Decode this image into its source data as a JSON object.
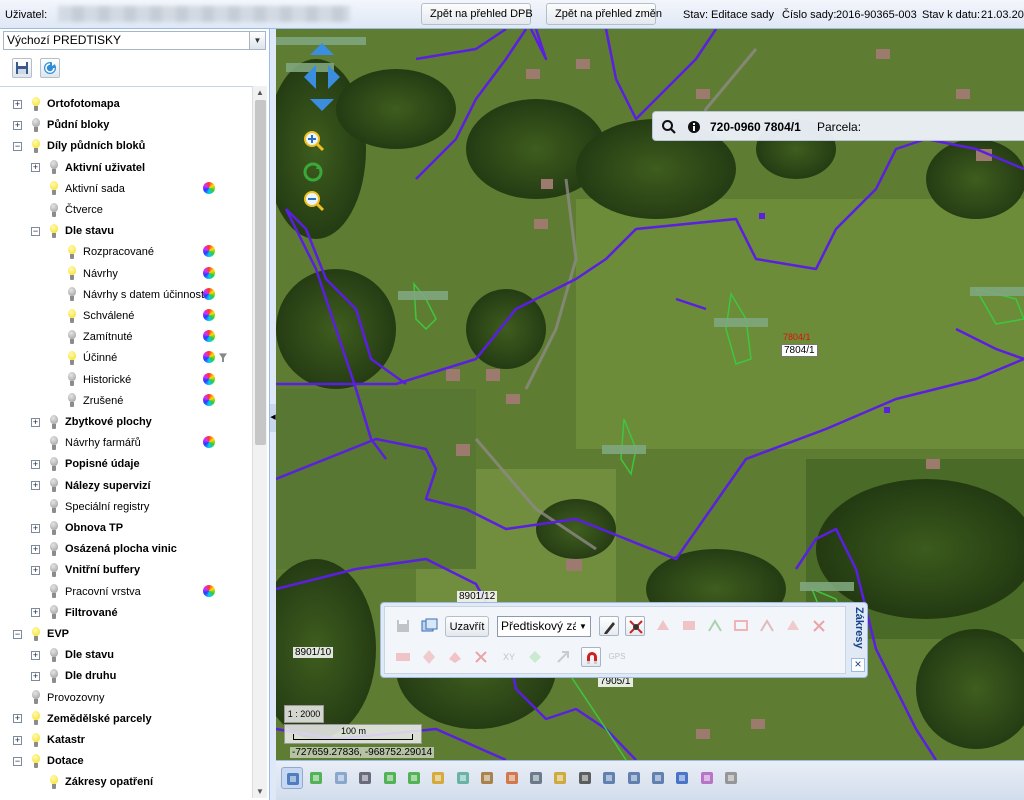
{
  "topbar": {
    "user_label": "Uživatel:",
    "btn_dpb": "Zpět na přehled DPB",
    "btn_changes": "Zpět na přehled změn",
    "state_label": "Stav:",
    "state_value": "Editace sady",
    "set_label": "Číslo sady:",
    "set_value": "2016-90365-003",
    "date_label": "Stav k datu:",
    "date_value": "21.03.20"
  },
  "left_panel": {
    "preset_value": "Výchozí PREDTISKY",
    "tools": [
      "save-icon",
      "refresh-icon"
    ],
    "tree": [
      {
        "label": "Ortofotomapa",
        "bold": true,
        "exp": "+",
        "bulb": "on",
        "indent": 0
      },
      {
        "label": "Půdní bloky",
        "bold": true,
        "exp": "+",
        "bulb": "off",
        "indent": 0
      },
      {
        "label": "Díly půdních bloků",
        "bold": true,
        "exp": "−",
        "bulb": "on",
        "indent": 0
      },
      {
        "label": "Aktivní uživatel",
        "bold": true,
        "exp": "+",
        "bulb": "off",
        "indent": 1
      },
      {
        "label": "Aktivní sada",
        "bold": false,
        "exp": "",
        "bulb": "on",
        "indent": 1,
        "wheel": true
      },
      {
        "label": "Čtverce",
        "bold": false,
        "exp": "",
        "bulb": "off",
        "indent": 1
      },
      {
        "label": "Dle stavu",
        "bold": true,
        "exp": "−",
        "bulb": "on",
        "indent": 1
      },
      {
        "label": "Rozpracované",
        "bold": false,
        "exp": "",
        "bulb": "on",
        "indent": 2,
        "wheel": true
      },
      {
        "label": "Návrhy",
        "bold": false,
        "exp": "",
        "bulb": "on",
        "indent": 2,
        "wheel": true
      },
      {
        "label": "Návrhy s datem účinnosti",
        "bold": false,
        "exp": "",
        "bulb": "off",
        "indent": 2,
        "wheel": true
      },
      {
        "label": "Schválené",
        "bold": false,
        "exp": "",
        "bulb": "on",
        "indent": 2,
        "wheel": true
      },
      {
        "label": "Zamítnuté",
        "bold": false,
        "exp": "",
        "bulb": "off",
        "indent": 2,
        "wheel": true
      },
      {
        "label": "Účinné",
        "bold": false,
        "exp": "",
        "bulb": "on",
        "indent": 2,
        "wheel": true,
        "filter": true
      },
      {
        "label": "Historické",
        "bold": false,
        "exp": "",
        "bulb": "off",
        "indent": 2,
        "wheel": true
      },
      {
        "label": "Zrušené",
        "bold": false,
        "exp": "",
        "bulb": "off",
        "indent": 2,
        "wheel": true
      },
      {
        "label": "Zbytkové plochy",
        "bold": true,
        "exp": "+",
        "bulb": "off",
        "indent": 1
      },
      {
        "label": "Návrhy farmářů",
        "bold": false,
        "exp": "",
        "bulb": "off",
        "indent": 1,
        "wheel": true
      },
      {
        "label": "Popisné údaje",
        "bold": true,
        "exp": "+",
        "bulb": "off",
        "indent": 1
      },
      {
        "label": "Nálezy supervizí",
        "bold": true,
        "exp": "+",
        "bulb": "off",
        "indent": 1
      },
      {
        "label": "Speciální registry",
        "bold": false,
        "exp": "",
        "bulb": "off",
        "indent": 1
      },
      {
        "label": "Obnova TP",
        "bold": true,
        "exp": "+",
        "bulb": "off",
        "indent": 1
      },
      {
        "label": "Osázená plocha vinic",
        "bold": true,
        "exp": "+",
        "bulb": "off",
        "indent": 1
      },
      {
        "label": "Vnitřní buffery",
        "bold": true,
        "exp": "+",
        "bulb": "off",
        "indent": 1
      },
      {
        "label": "Pracovní vrstva",
        "bold": false,
        "exp": "",
        "bulb": "off",
        "indent": 1,
        "wheel": true
      },
      {
        "label": "Filtrované",
        "bold": true,
        "exp": "+",
        "bulb": "off",
        "indent": 1
      },
      {
        "label": "EVP",
        "bold": true,
        "exp": "−",
        "bulb": "on",
        "indent": 0
      },
      {
        "label": "Dle stavu",
        "bold": true,
        "exp": "+",
        "bulb": "off",
        "indent": 1
      },
      {
        "label": "Dle druhu",
        "bold": true,
        "exp": "+",
        "bulb": "off",
        "indent": 1
      },
      {
        "label": "Provozovny",
        "bold": false,
        "exp": "",
        "bulb": "off",
        "indent": 0
      },
      {
        "label": "Zemědělské parcely",
        "bold": true,
        "exp": "+",
        "bulb": "on",
        "indent": 0
      },
      {
        "label": "Katastr",
        "bold": true,
        "exp": "+",
        "bulb": "on",
        "indent": 0
      },
      {
        "label": "Dotace",
        "bold": true,
        "exp": "−",
        "bulb": "on",
        "indent": 0
      },
      {
        "label": "Zákresy opatření",
        "bold": true,
        "exp": "",
        "bulb": "on",
        "indent": 1
      }
    ]
  },
  "map": {
    "info_block": "720-0960 7804/1",
    "info_parcel_label": "Parcela:",
    "parcel_labels": {
      "p1": "7804/1",
      "p2": "8901/12",
      "p3": "8901/10",
      "p4": "7905/1",
      "red1": "7804/1"
    },
    "scale_text": "1 : 2000",
    "scalebar_text": "100 m",
    "coords_text": "-727659.27836, -968752.29014",
    "colors": {
      "boundary": "#5a1fe0",
      "drawing": "#3fc63f",
      "label_red": "#e01010"
    }
  },
  "draw_panel": {
    "title": "Zákresy",
    "close_btn": "×",
    "close_label": "Uzavřít",
    "select_value": "Předtiskový zá",
    "row1_icons": [
      "save-icon",
      "window-icon",
      "close-button",
      "select",
      "pencil-icon",
      "cross-tool-icon",
      "polygon-add-icon",
      "polygon-cut-icon",
      "vertex-edit-icon",
      "polygon-split-icon",
      "merge-icon",
      "clip-icon",
      "delete-polygon-icon"
    ],
    "row2_icons": [
      "buffer-icon",
      "shift-icon",
      "eraser-icon",
      "remove-icon",
      "xy-icon",
      "fill-icon",
      "arrow-icon",
      "magnet-icon",
      "gps-icon"
    ],
    "xy_label": "XY",
    "gps_label": "GPS"
  },
  "bottom_toolbar": {
    "icons": [
      "draw-tool-icon",
      "refresh-icon",
      "rectangle-icon",
      "select-icon",
      "down-arrow-icon",
      "down-arrow-icon",
      "pencil-ruler-icon",
      "layers-icon",
      "broom-icon",
      "export-icon",
      "phone-icon",
      "note-icon",
      "binoculars-icon",
      "print-icon",
      "print-icon",
      "print-icon",
      "network-icon",
      "edit-icon",
      "settings-icon"
    ]
  }
}
